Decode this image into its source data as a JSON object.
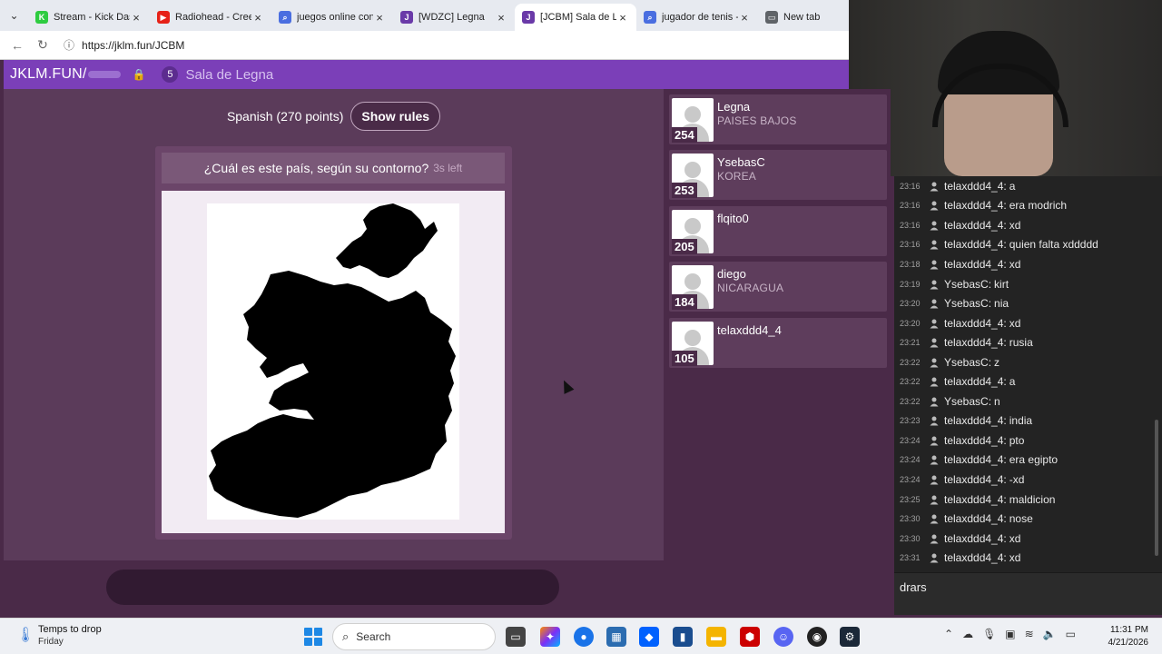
{
  "browser": {
    "tabs": [
      {
        "title": "Stream - Kick Dashb",
        "favicon_color": "#2ecc40",
        "favicon": "K"
      },
      {
        "title": "Radiohead - Creep",
        "favicon_color": "#e62117",
        "favicon": "▶"
      },
      {
        "title": "juegos online con a",
        "favicon_color": "#4a6ee0",
        "favicon": "⌕"
      },
      {
        "title": "[WDZC] Legna",
        "favicon_color": "#6a3aa8",
        "favicon": "J"
      },
      {
        "title": "[JCBM] Sala de Leg",
        "favicon_color": "#6a3aa8",
        "favicon": "J"
      },
      {
        "title": "jugador de tenis - S",
        "favicon_color": "#4a6ee0",
        "favicon": "⌕"
      },
      {
        "title": "New tab",
        "favicon_color": "#5f6368",
        "favicon": "▭"
      }
    ],
    "active_tab_index": 4,
    "url": "https://jklm.fun/JCBM"
  },
  "site": {
    "brand": "JKLM.FUN/",
    "player_count": "5",
    "room_name": "Sala de Legna"
  },
  "game": {
    "language": "Spanish (270 points)",
    "show_rules": "Show rules",
    "question": "¿Cuál es este país, según su contorno?",
    "time_left": "3s left",
    "answer_value": ""
  },
  "players": [
    {
      "name": "Legna",
      "guess": "PAISES BAJOS",
      "score": "254"
    },
    {
      "name": "YsebasC",
      "guess": "KOREA",
      "score": "253"
    },
    {
      "name": "flqito0",
      "guess": "",
      "score": "205"
    },
    {
      "name": "diego",
      "guess": "NICARAGUA",
      "score": "184"
    },
    {
      "name": "telaxddd4_4",
      "guess": "",
      "score": "105"
    }
  ],
  "chat": {
    "messages": [
      {
        "time": "23:16",
        "user": "telaxddd4_4:",
        "text": "a"
      },
      {
        "time": "23:16",
        "user": "telaxddd4_4:",
        "text": "era modrich"
      },
      {
        "time": "23:16",
        "user": "telaxddd4_4:",
        "text": "xd"
      },
      {
        "time": "23:16",
        "user": "telaxddd4_4:",
        "text": "quien falta xddddd"
      },
      {
        "time": "23:18",
        "user": "telaxddd4_4:",
        "text": "xd"
      },
      {
        "time": "23:19",
        "user": "YsebasC:",
        "text": "kirt"
      },
      {
        "time": "23:20",
        "user": "YsebasC:",
        "text": "nia"
      },
      {
        "time": "23:20",
        "user": "telaxddd4_4:",
        "text": "xd"
      },
      {
        "time": "23:21",
        "user": "telaxddd4_4:",
        "text": "rusia"
      },
      {
        "time": "23:22",
        "user": "YsebasC:",
        "text": "z"
      },
      {
        "time": "23:22",
        "user": "telaxddd4_4:",
        "text": "a"
      },
      {
        "time": "23:22",
        "user": "YsebasC:",
        "text": "n"
      },
      {
        "time": "23:23",
        "user": "telaxddd4_4:",
        "text": "india"
      },
      {
        "time": "23:24",
        "user": "telaxddd4_4:",
        "text": "pto"
      },
      {
        "time": "23:24",
        "user": "telaxddd4_4:",
        "text": "era egipto"
      },
      {
        "time": "23:24",
        "user": "telaxddd4_4:",
        "text": "-xd"
      },
      {
        "time": "23:25",
        "user": "telaxddd4_4:",
        "text": "maldicion"
      },
      {
        "time": "23:30",
        "user": "telaxddd4_4:",
        "text": "nose"
      },
      {
        "time": "23:30",
        "user": "telaxddd4_4:",
        "text": "xd"
      },
      {
        "time": "23:31",
        "user": "telaxddd4_4:",
        "text": "xd"
      }
    ],
    "input_value": "drars"
  },
  "taskbar": {
    "weather_title": "Temps to drop",
    "weather_sub": "Friday",
    "search_placeholder": "Search",
    "time": "11:31 PM",
    "date": "4/21/2026"
  },
  "colors": {
    "site_header": "#7b3fb8",
    "game_bg": "#5b3b5a",
    "chat_bg": "#232323"
  }
}
